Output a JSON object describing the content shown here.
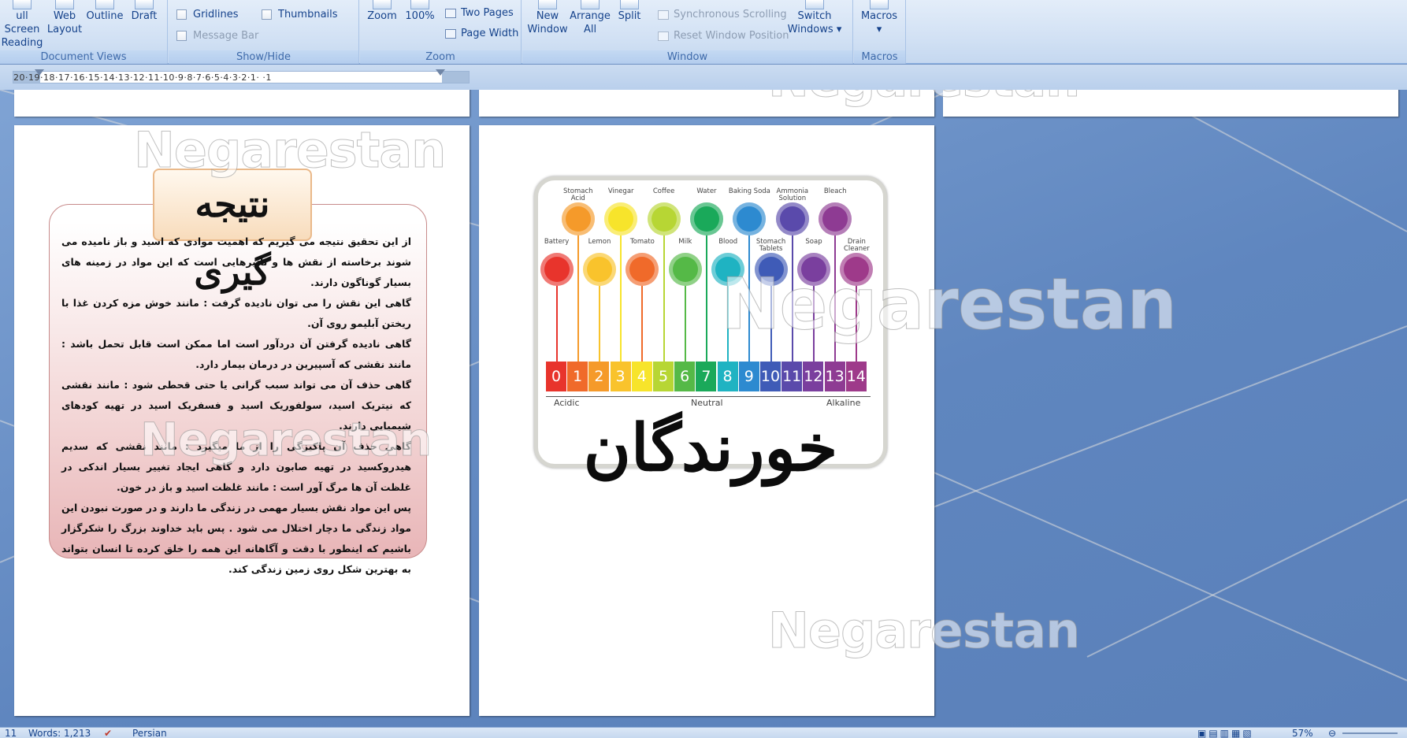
{
  "ribbon": {
    "groups": {
      "document_views": {
        "title": "Document Views",
        "buttons": [
          {
            "line1": "ull Screen",
            "line2": "Reading",
            "icon": "full-screen-reading-icon"
          },
          {
            "line1": "Web",
            "line2": "Layout",
            "icon": "web-layout-icon"
          },
          {
            "line1": "Outline",
            "line2": "",
            "icon": "outline-icon"
          },
          {
            "line1": "Draft",
            "line2": "",
            "icon": "draft-icon"
          }
        ]
      },
      "show_hide": {
        "title": "Show/Hide",
        "gridlines": "Gridlines",
        "thumbnails": "Thumbnails",
        "message_bar": "Message Bar"
      },
      "zoom": {
        "title": "Zoom",
        "zoom": "Zoom",
        "percent": "100%",
        "two_pages": "Two Pages",
        "page_width": "Page Width"
      },
      "window": {
        "title": "Window",
        "new_window_1": "New",
        "new_window_2": "Window",
        "arrange_1": "Arrange",
        "arrange_2": "All",
        "split": "Split",
        "sync_scrolling": "Synchronous Scrolling",
        "reset_window": "Reset Window Position",
        "switch_1": "Switch",
        "switch_2": "Windows"
      },
      "macros": {
        "title": "Macros",
        "label": "Macros"
      }
    }
  },
  "ruler": {
    "text": "20·19·18·17·16·15·14·13·12·11·10·9·8·7·6·5·4·3·2·1·  ·1"
  },
  "watermark": "Negarestan",
  "conclusion": {
    "title": "نتیجه گیری",
    "paragraphs": [
      "از این تحقیق نتیجه می گیریم که اهمیت موادی که اسید و باز نامیده می شوند برخاسته از نقش ها و تاثیرهایی است که این مواد در زمینه های بسیار گوناگون دارند.",
      "گاهی این نقش را می توان نادیده گرفت : مانند خوش مزه کردن غذا با ریختن آبلیمو روی آن.",
      "گاهی نادیده گرفتن آن دردآور است اما ممکن است قابل تحمل باشد : مانند نقشی که آسپیرین در درمان بیمار دارد.",
      "گاهی حذف آن می تواند سبب گرانی یا حتی قحطی شود : مانند نقشی که نیتریک اسید، سولفوریک اسید و فسفریک اسید در تهیه کودهای شیمیایی دارند.",
      "گاهی حذف آن پاکیزگی را از ما میگیرد : مانند نقشی که سدیم هیدروکسید در تهیه صابون دارد و گاهی ایجاد تغییر بسیار اندکی در غلظت آن ها مرگ آور است : مانند غلظت اسید و باز در خون.",
      "پس این مواد نقش بسیار مهمی در زندگی ما دارند و در صورت نبودن این مواد زندگی ما دچار اختلال می شود . پس باید خداوند بزرگ را شکرگزار باشیم که اینطور با دقت و آگاهانه این همه را خلق کرده تا انسان بتواند به بهترین شکل روی زمین زندگی کند."
    ]
  },
  "ph_chart": {
    "top_items": [
      "Stomach Acid",
      "Vinegar",
      "Coffee",
      "Water",
      "Baking Soda",
      "Ammonia Solution",
      "Bleach"
    ],
    "bottom_items": [
      "Battery",
      "Lemon",
      "Tomato",
      "Milk",
      "Blood",
      "Stomach Tablets",
      "Soap",
      "Drain Cleaner"
    ],
    "scale": [
      "0",
      "1",
      "2",
      "3",
      "4",
      "5",
      "6",
      "7",
      "8",
      "9",
      "10",
      "11",
      "12",
      "13",
      "14"
    ],
    "scale_colors": [
      "#e8342c",
      "#f06a2a",
      "#f59a2a",
      "#f9c32c",
      "#f7e42b",
      "#b7d634",
      "#55b947",
      "#1aa95a",
      "#1fb3c2",
      "#2d8ad0",
      "#3f5bb7",
      "#5a4aab",
      "#7a3f9e",
      "#8e3b93",
      "#9e3a8a"
    ],
    "label_acidic": "Acidic",
    "label_neutral": "Neutral",
    "label_alkaline": "Alkaline",
    "title": "خورندگان"
  },
  "status": {
    "page": "11",
    "words": "Words: 1,213",
    "language": "Persian",
    "zoom": "57%"
  }
}
